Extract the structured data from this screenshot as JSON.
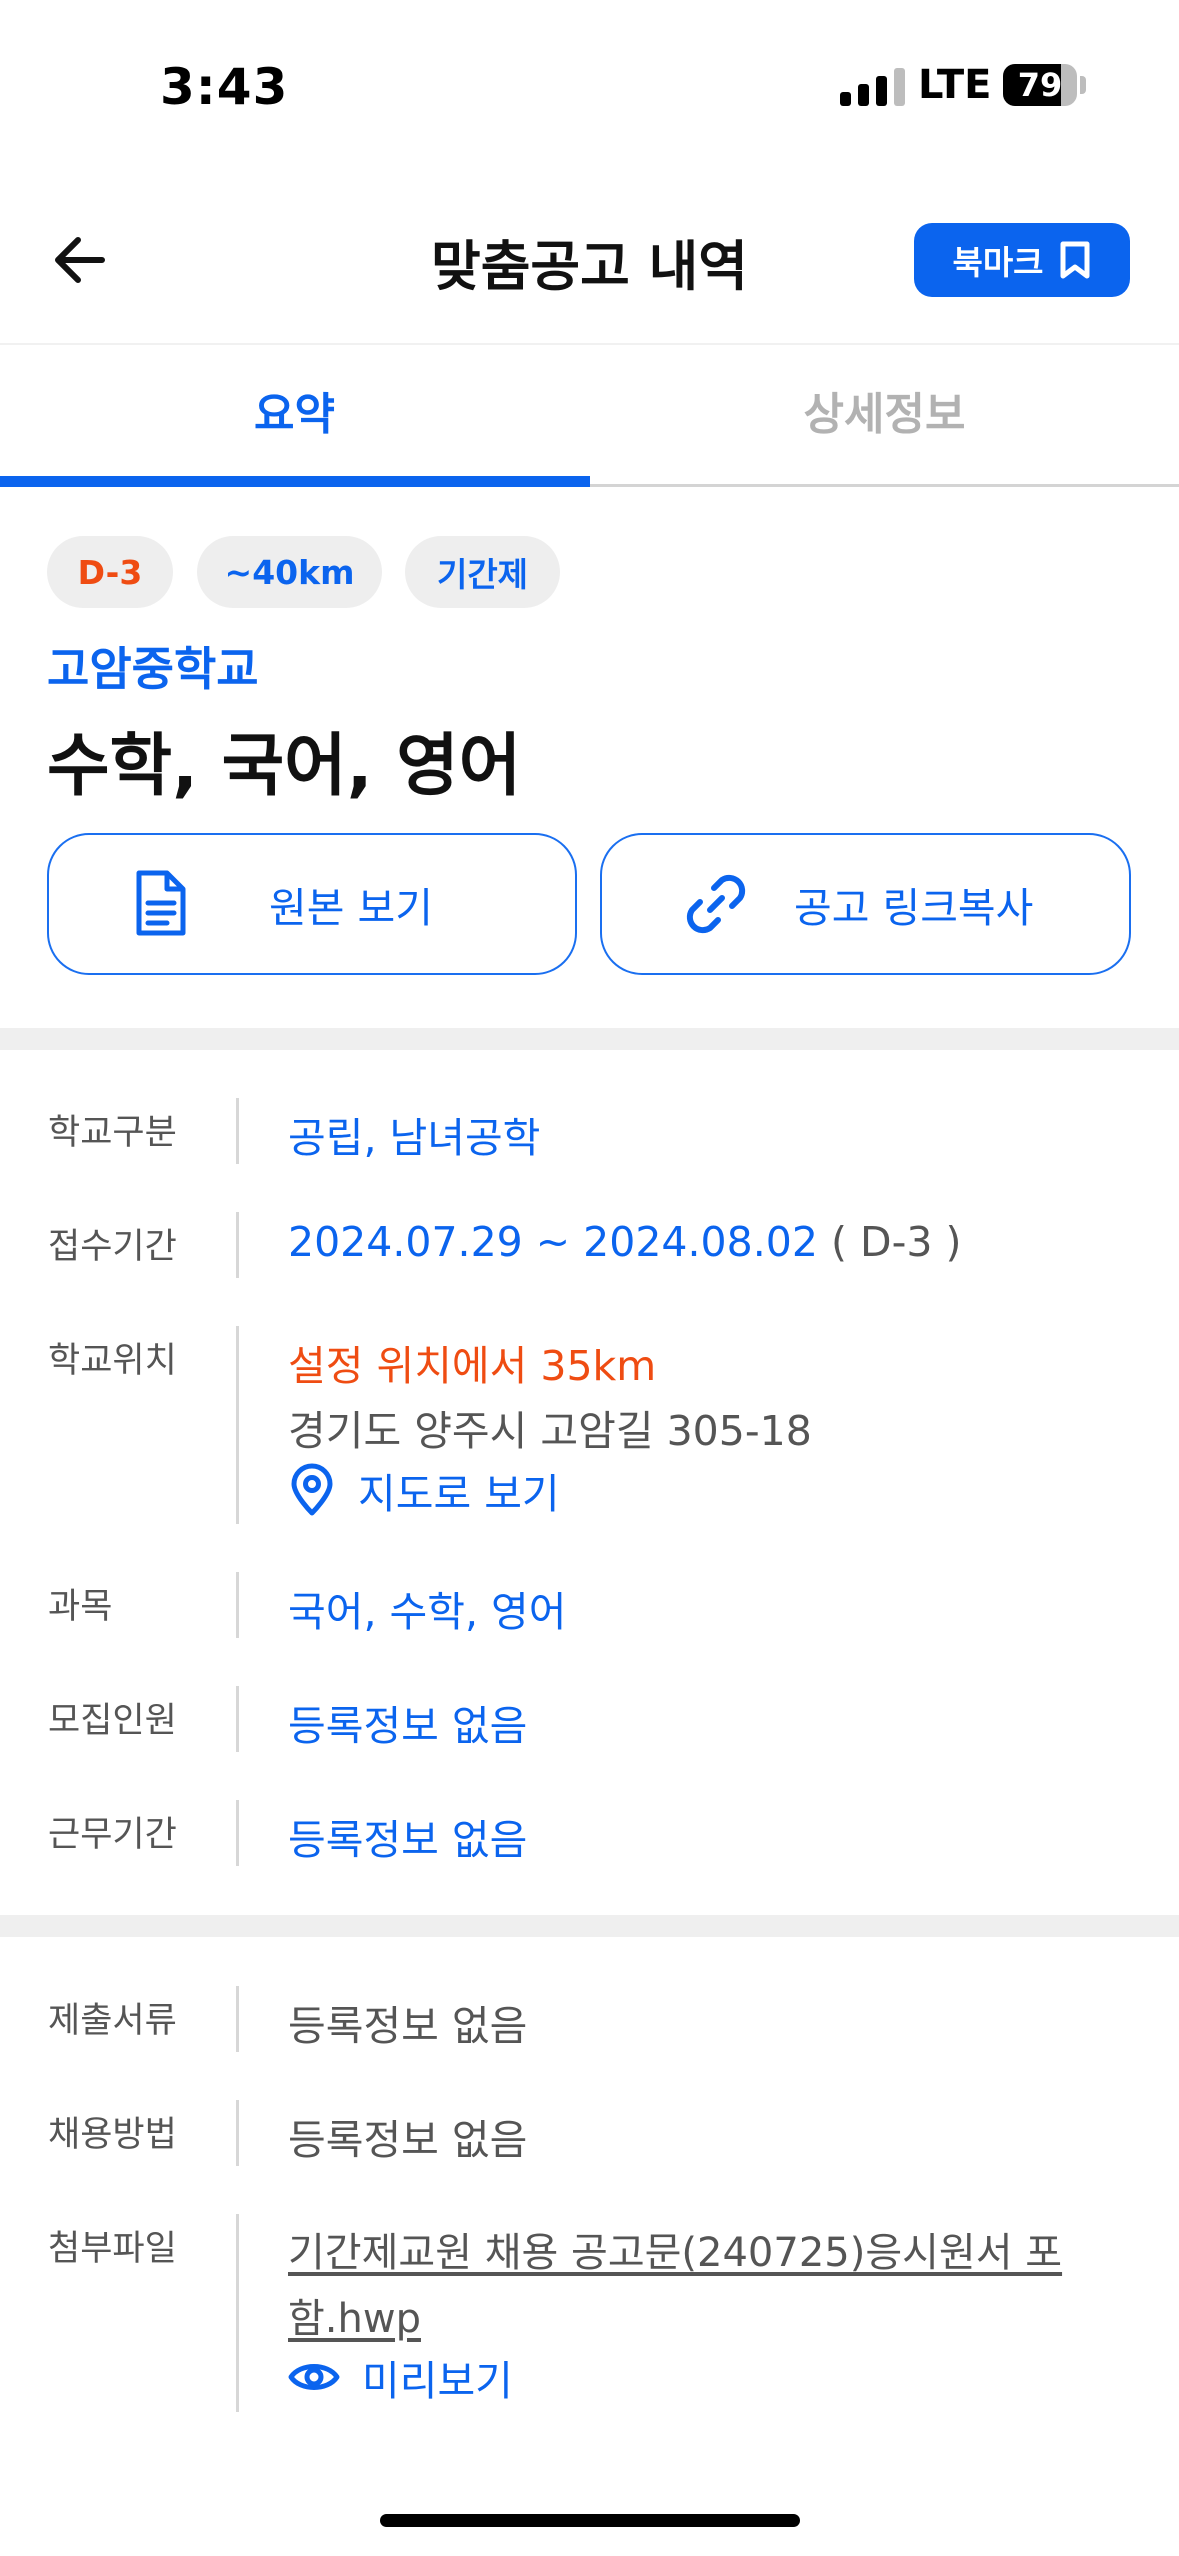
{
  "status_bar": {
    "time": "3:43",
    "network": "LTE",
    "battery_percent": 79
  },
  "header": {
    "title": "맞춤공고 내역",
    "bookmark_label": "북마크"
  },
  "tabs": [
    {
      "label": "요약",
      "active": true
    },
    {
      "label": "상세정보",
      "active": false
    }
  ],
  "chips": [
    {
      "label": "D-3",
      "color": "#ef4c12"
    },
    {
      "label": "~40km",
      "color": "#0b64ee"
    },
    {
      "label": "기간제",
      "color": "#0b64ee"
    }
  ],
  "school_name": "고암중학교",
  "subject_title": "수학, 국어, 영어",
  "actions": {
    "view_original": "원본 보기",
    "copy_link": "공고 링크복사"
  },
  "info": {
    "school_type": {
      "label": "학교구분",
      "value": "공립, 남녀공학"
    },
    "period": {
      "label": "접수기간",
      "value": "2024.07.29 ~ 2024.08.02",
      "dday": "( D-3 )"
    },
    "location": {
      "label": "학교위치",
      "distance": "설정 위치에서 35km",
      "address": "경기도 양주시 고암길 305-18",
      "map_link": "지도로 보기"
    },
    "subject": {
      "label": "과목",
      "value": "국어, 수학, 영어"
    },
    "recruit": {
      "label": "모집인원",
      "value": "등록정보 없음"
    },
    "work_period": {
      "label": "근무기간",
      "value": "등록정보 없음"
    }
  },
  "docs": {
    "documents": {
      "label": "제출서류",
      "value": "등록정보 없음"
    },
    "method": {
      "label": "채용방법",
      "value": "등록정보 없음"
    },
    "attachment": {
      "label": "첨부파일",
      "file_line1": "기간제교원 채용 공고문(240725)응시원서 포",
      "file_line2": "함.hwp",
      "preview": "미리보기"
    }
  },
  "colors": {
    "accent": "#0b64ee",
    "warning": "#ef4c12"
  }
}
